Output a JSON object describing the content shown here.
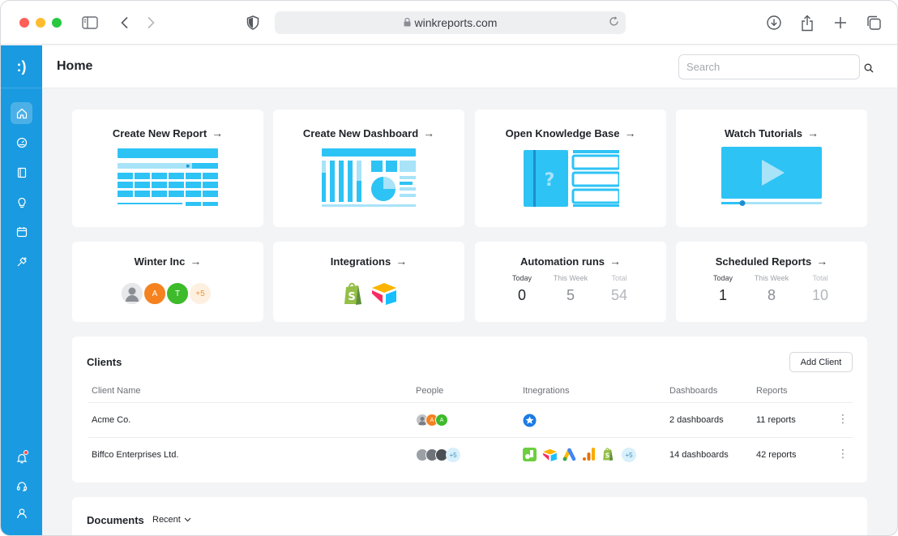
{
  "browser": {
    "url": "winkreports.com"
  },
  "app": {
    "logo": ":)"
  },
  "header": {
    "title": "Home",
    "search_placeholder": "Search"
  },
  "quick_actions": [
    {
      "label": "Create New Report"
    },
    {
      "label": "Create New Dashboard"
    },
    {
      "label": "Open Knowledge Base"
    },
    {
      "label": "Watch Tutorials"
    }
  ],
  "workspace": {
    "label": "Winter Inc",
    "members": [
      "A",
      "T"
    ],
    "extra": "+5"
  },
  "integrations_card": {
    "label": "Integrations",
    "icons": [
      "shopify-icon",
      "airtable-icon"
    ]
  },
  "automation_runs": {
    "label": "Automation runs",
    "stats": [
      {
        "label": "Today",
        "value": "0"
      },
      {
        "label": "This Week",
        "value": "5"
      },
      {
        "label": "Total",
        "value": "54"
      }
    ]
  },
  "scheduled_reports": {
    "label": "Scheduled Reports",
    "stats": [
      {
        "label": "Today",
        "value": "1"
      },
      {
        "label": "This Week",
        "value": "8"
      },
      {
        "label": "Total",
        "value": "10"
      }
    ]
  },
  "clients": {
    "title": "Clients",
    "add_label": "Add Client",
    "columns": [
      "Client Name",
      "People",
      "Itnegrations",
      "Dashboards",
      "Reports"
    ],
    "rows": [
      {
        "name": "Acme Co.",
        "people": [
          "A",
          "A"
        ],
        "people_extra": "",
        "integrations_extra": "",
        "dashboards": "2 dashboards",
        "reports": "11 reports"
      },
      {
        "name": "Biffco Enterprises Ltd.",
        "people": [],
        "people_extra": "+5",
        "integrations_extra": "+5",
        "dashboards": "14 dashboards",
        "reports": "42 reports"
      }
    ]
  },
  "documents": {
    "title": "Documents",
    "filter": "Recent"
  },
  "colors": {
    "sidebar": "#1a9ae0",
    "accent": "#2ec3f5",
    "background": "#f3f4f6"
  }
}
